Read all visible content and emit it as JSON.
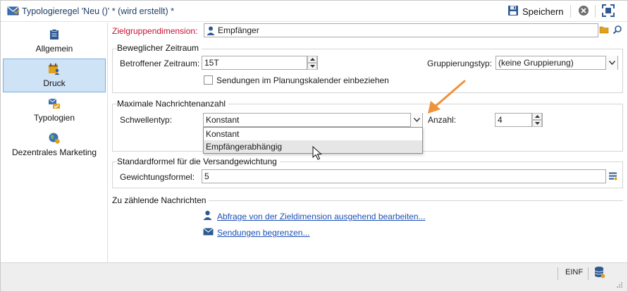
{
  "window": {
    "title": "Typologieregel 'Neu ()' * (wird erstellt) *",
    "save_label": "Speichern"
  },
  "sidebar": {
    "items": [
      {
        "label": "Allgemein",
        "icon": "clipboard-icon"
      },
      {
        "label": "Druck",
        "icon": "calendar-user-icon",
        "active": true
      },
      {
        "label": "Typologien",
        "icon": "typology-icon"
      },
      {
        "label": "Dezentrales Marketing",
        "icon": "globe-icon"
      }
    ]
  },
  "form": {
    "target_dimension_label": "Zielgruppendimension:",
    "target_dimension_value": "Empfänger",
    "period_group": {
      "title": "Beweglicher Zeitraum",
      "period_label": "Betroffener Zeitraum:",
      "period_value": "15T",
      "grouping_label": "Gruppierungstyp:",
      "grouping_value": "(keine Gruppierung)",
      "calendar_checkbox_label": "Sendungen im Planungskalender einbeziehen"
    },
    "max_group": {
      "title": "Maximale Nachrichtenanzahl",
      "threshold_label": "Schwellentyp:",
      "threshold_value": "Konstant",
      "threshold_options": [
        "Konstant",
        "Empfängerabhängig"
      ],
      "count_label": "Anzahl:",
      "count_value": "4"
    },
    "weight_group": {
      "title": "Standardformel für die Versandgewichtung",
      "formula_label": "Gewichtungsformel:",
      "formula_value": "5"
    },
    "messages_group": {
      "title": "Zu zählende Nachrichten",
      "link_query": "Abfrage von der Zieldimension ausgehend bearbeiten...",
      "link_limit": "Sendungen begrenzen..."
    }
  },
  "statusbar": {
    "language": "EINF"
  },
  "colors": {
    "accent": "#1c4fb5",
    "required_label": "#c8102e",
    "annotation_arrow": "#f0923a",
    "active_tab": "#cfe3f7"
  }
}
